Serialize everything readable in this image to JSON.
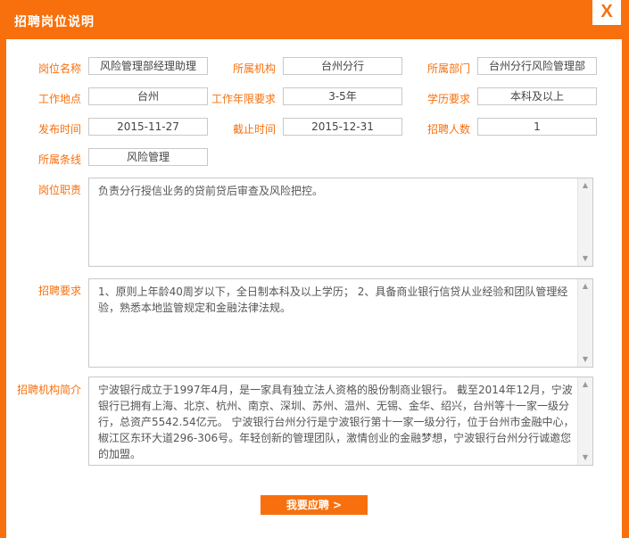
{
  "dialog": {
    "title": "招聘岗位说明",
    "close_label": "X"
  },
  "labels": {
    "position_name": "岗位名称",
    "institution": "所属机构",
    "department": "所属部门",
    "work_location": "工作地点",
    "work_years": "工作年限要求",
    "education": "学历要求",
    "publish_time": "发布时间",
    "deadline": "截止时间",
    "headcount": "招聘人数",
    "line": "所属条线",
    "duties": "岗位职责",
    "requirements": "招聘要求",
    "org_intro": "招聘机构简介"
  },
  "values": {
    "position_name": "风险管理部经理助理",
    "institution": "台州分行",
    "department": "台州分行风险管理部",
    "work_location": "台州",
    "work_years": "3-5年",
    "education": "本科及以上",
    "publish_time": "2015-11-27",
    "deadline": "2015-12-31",
    "headcount": "1",
    "line": "风险管理",
    "duties": "负责分行授信业务的贷前贷后审查及风险把控。",
    "requirements": "1、原则上年龄40周岁以下，全日制本科及以上学历；  2、具备商业银行信贷从业经验和团队管理经验，熟悉本地监管规定和金融法律法规。",
    "org_intro": "宁波银行成立于1997年4月，是一家具有独立法人资格的股份制商业银行。 截至2014年12月，宁波银行已拥有上海、北京、杭州、南京、深圳、苏州、温州、无锡、金华、绍兴，台州等十一家一级分行，总资产5542.54亿元。 宁波银行台州分行是宁波银行第十一家一级分行，位于台州市金融中心，椒江区东环大道296-306号。年轻创新的管理团队，激情创业的金融梦想，宁波银行台州分行诚邀您的加盟。"
  },
  "actions": {
    "apply_label": "我要应聘 >"
  },
  "icons": {
    "scroll_up": "chevron-up-icon",
    "scroll_down": "chevron-down-icon"
  },
  "colors": {
    "accent": "#f7700d"
  }
}
